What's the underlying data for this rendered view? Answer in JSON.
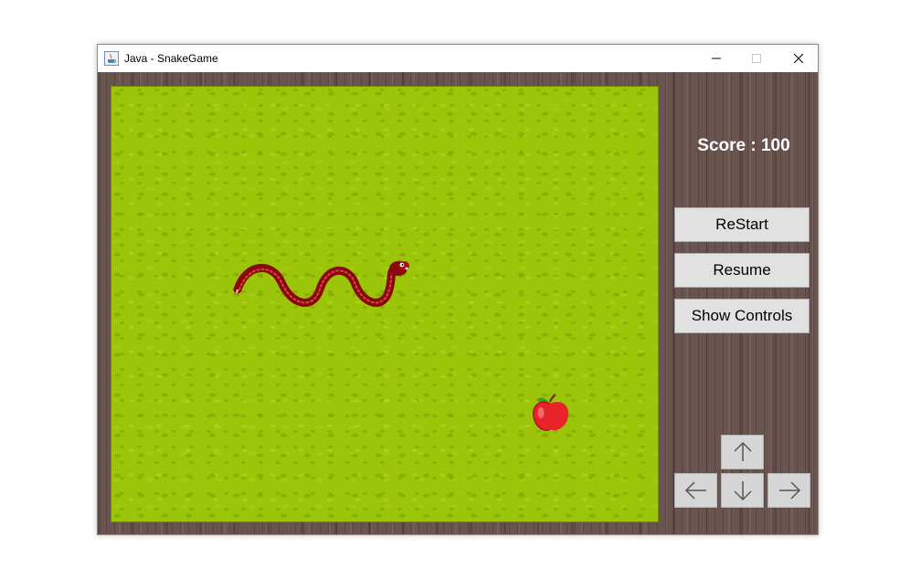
{
  "window": {
    "title": "Java - SnakeGame",
    "icon": "java-coffee-icon",
    "controls": [
      "minimize-icon",
      "maximize-icon",
      "close-icon"
    ]
  },
  "game": {
    "score_label": "Score : 100",
    "snake_color": "#9b0b0b",
    "apple_color": "#e8242a",
    "board_color": "#9cc409",
    "wood_color": "#6a5450"
  },
  "buttons": {
    "restart": "ReStart",
    "resume": "Resume",
    "show_controls": "Show Controls"
  },
  "arrows": [
    "arrow-up-icon",
    "arrow-left-icon",
    "arrow-down-icon",
    "arrow-right-icon"
  ]
}
